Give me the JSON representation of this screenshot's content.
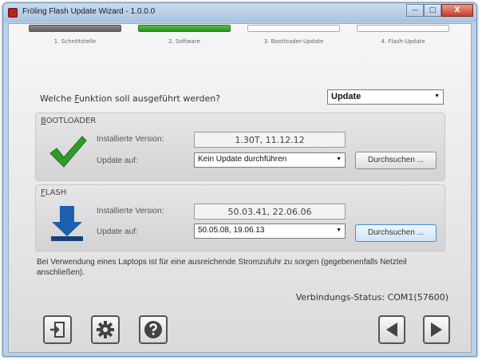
{
  "window": {
    "title": "Fröling Flash Update Wizard - 1.0.0.0",
    "close_label": "X"
  },
  "steps": [
    {
      "label": "1. Schnittstelle",
      "state": "done"
    },
    {
      "label": "2. Software",
      "state": "active"
    },
    {
      "label": "3. Bootloader-Update",
      "state": "pending"
    },
    {
      "label": "4. Flash-Update",
      "state": "pending"
    }
  ],
  "question": {
    "prefix": "Welche ",
    "accel": "F",
    "suffix": "unktion soll ausgeführt werden?"
  },
  "mode": {
    "value": "Update"
  },
  "bootloader": {
    "title_accel": "B",
    "title_rest": "OOTLOADER",
    "installed_label": "Installierte Version:",
    "installed_value": "1.30T, 11.12.12",
    "update_label": "Update auf:",
    "update_value": "Kein Update durchführen",
    "browse_label": "Durchsuchen ...",
    "icon": "checkmark-icon",
    "icon_color": "#2e9a2a"
  },
  "flash": {
    "title_accel": "F",
    "title_rest": "LASH",
    "installed_label": "Installierte Version:",
    "installed_value": "50.03.41, 22.06.06",
    "update_label": "Update auf:",
    "update_value": "50.05.08, 19.06.13",
    "browse_label": "Durchsuchen ...",
    "icon": "download-arrow-icon",
    "icon_color": "#1f5fb0"
  },
  "note": "Bei Verwendung eines Laptops ist für eine ausreichende Stromzufuhr zu sorgen (gegebenenfalls Netzteil anschließen).",
  "status": "Verbindungs-Status: COM1(57600)",
  "toolbar": {
    "exit_icon": "exit-icon",
    "settings_icon": "gear-icon",
    "help_icon": "help-icon",
    "back_icon": "back-arrow-icon",
    "next_icon": "next-arrow-icon"
  },
  "colors": {
    "accent_green": "#3fae34",
    "step_done": "#6a6a6a"
  }
}
